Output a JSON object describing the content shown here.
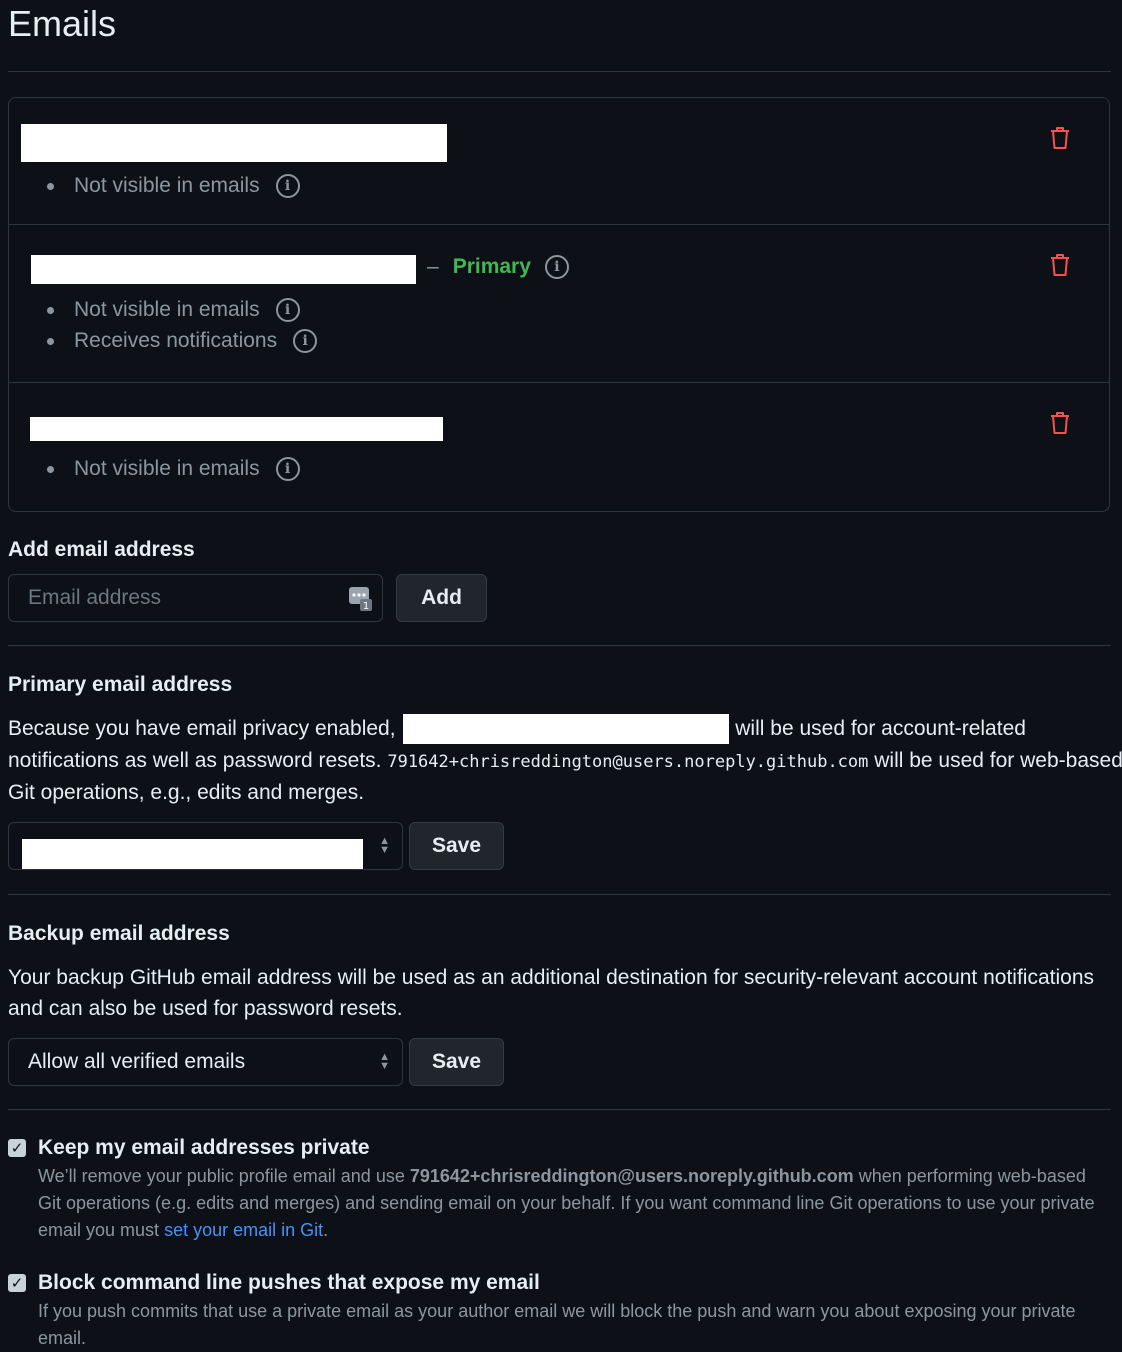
{
  "page": {
    "title": "Emails"
  },
  "emails": [
    {
      "status": [
        "Not visible in emails"
      ]
    },
    {
      "primary_label": "Primary",
      "status": [
        "Not visible in emails",
        "Receives notifications"
      ]
    },
    {
      "status": [
        "Not visible in emails"
      ]
    }
  ],
  "add_email": {
    "heading": "Add email address",
    "placeholder": "Email address",
    "button": "Add"
  },
  "primary_email": {
    "heading": "Primary email address",
    "text_1": "Because you have email privacy enabled,",
    "text_2": "will be used for account-related",
    "text_3": "notifications as well as password resets.",
    "noreply": "791642+chrisreddington@users.noreply.github.com",
    "text_4": "will be used for web-based",
    "text_5": "Git operations, e.g., edits and merges.",
    "button": "Save"
  },
  "backup_email": {
    "heading": "Backup email address",
    "description": "Your backup GitHub email address will be used as an additional destination for security-relevant account notifications and can also be used for password resets.",
    "selected": "Allow all verified emails",
    "button": "Save"
  },
  "keep_private": {
    "label": "Keep my email addresses private",
    "checked": true,
    "desc_1": "We’ll remove your public profile email and use",
    "desc_email": "791642+chrisreddington@users.noreply.github.com",
    "desc_2": "when performing web-based Git operations (e.g. edits and merges) and sending email on your behalf. If you want command line Git operations to use your private email you must",
    "desc_link": "set your email in Git",
    "desc_end": "."
  },
  "block_pushes": {
    "label": "Block command line pushes that expose my email",
    "checked": true,
    "description": "If you push commits that use a private email as your author email we will block the push and warn you about exposing your private email."
  },
  "colors": {
    "primary": "#3fb950",
    "danger": "#f85149",
    "link": "#4493f8"
  },
  "icons": [
    "trash-icon",
    "info-icon",
    "password-manager-icon",
    "select-caret-icon",
    "checkbox-check-icon"
  ]
}
